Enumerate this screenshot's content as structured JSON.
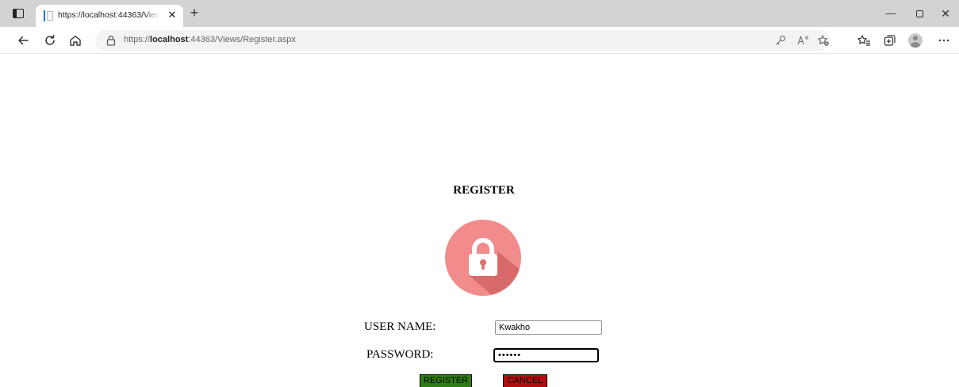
{
  "browser": {
    "tab": {
      "title": "https://localhost:44363/Views/Register.aspx",
      "close_glyph": "✕"
    },
    "new_tab_glyph": "+",
    "window_controls": {
      "minimize": "—",
      "close": "✕"
    },
    "address": {
      "scheme": "https://",
      "host": "localhost",
      "rest": ":44363/Views/Register.aspx"
    },
    "icons": [
      "tab-actions",
      "back",
      "refresh",
      "home",
      "lock",
      "key",
      "read-aloud",
      "add-favorite",
      "favorites",
      "collections",
      "profile",
      "more"
    ]
  },
  "page": {
    "title": "REGISTER",
    "lock_colors": {
      "circle": "#f28b8b",
      "shadow": "#d96a6a",
      "lock": "#ffffff"
    },
    "username": {
      "label": "USER NAME:",
      "value": "Kwakho"
    },
    "password": {
      "label": "PASSWORD:",
      "value": "••••••"
    },
    "buttons": {
      "register": {
        "label": "REGISTER",
        "color": "#2e7d14"
      },
      "cancel": {
        "label": "CANCEL",
        "color": "#b00f0f"
      }
    }
  }
}
